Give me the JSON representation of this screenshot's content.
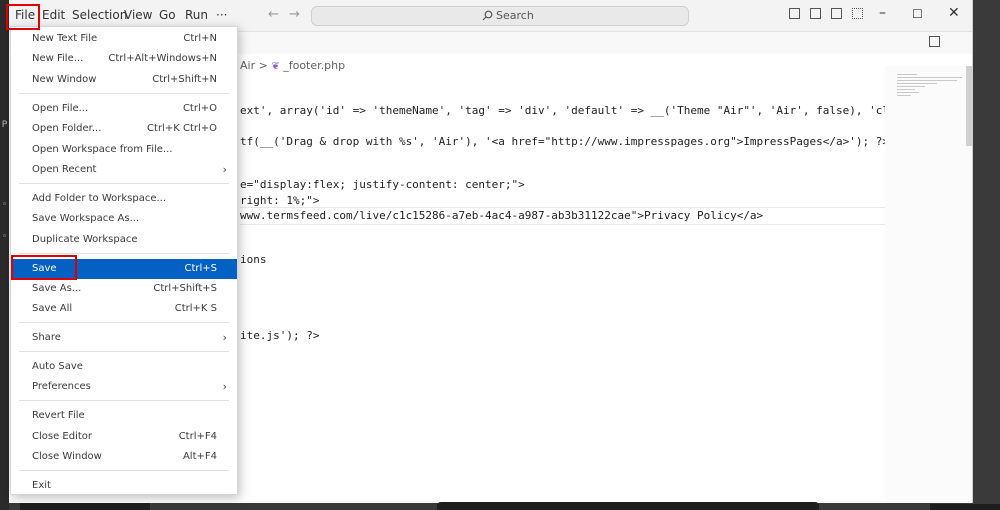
{
  "menubar": {
    "items": [
      "File",
      "Edit",
      "Selection",
      "View",
      "Go",
      "Run",
      "···"
    ]
  },
  "search": {
    "label": "Search"
  },
  "breadcrumb": {
    "folder": "Air",
    "separator": ">",
    "file": "_footer.php"
  },
  "code": {
    "lines": [
      "ext', array('id' => 'themeName', 'tag' => 'div', 'default' => __('Theme \"Air\"', 'Air', false), 'class' => '",
      "tf(__('Drag & drop with %s', 'Air'), '<a href=\"http://www.impresspages.org\">ImpressPages</a>'); ?>",
      "e=\"display:flex; justify-content: center;\">",
      "right: 1%;\">",
      "www.termsfeed.com/live/c1c15286-a7eb-4ac4-a987-ab3b31122cae\">Privacy Policy</a>",
      "ions",
      "ite.js'); ?>"
    ]
  },
  "file_menu": {
    "items": [
      {
        "label": "New Text File",
        "shortcut": "Ctrl+N"
      },
      {
        "label": "New File...",
        "shortcut": "Ctrl+Alt+Windows+N"
      },
      {
        "label": "New Window",
        "shortcut": "Ctrl+Shift+N"
      },
      {
        "label": "Open File...",
        "shortcut": "Ctrl+O"
      },
      {
        "label": "Open Folder...",
        "shortcut": "Ctrl+K Ctrl+O"
      },
      {
        "label": "Open Workspace from File...",
        "shortcut": ""
      },
      {
        "label": "Open Recent",
        "shortcut": ""
      },
      {
        "label": "Add Folder to Workspace...",
        "shortcut": ""
      },
      {
        "label": "Save Workspace As...",
        "shortcut": ""
      },
      {
        "label": "Duplicate Workspace",
        "shortcut": ""
      },
      {
        "label": "Save",
        "shortcut": "Ctrl+S"
      },
      {
        "label": "Save As...",
        "shortcut": "Ctrl+Shift+S"
      },
      {
        "label": "Save All",
        "shortcut": "Ctrl+K S"
      },
      {
        "label": "Share",
        "shortcut": ""
      },
      {
        "label": "Auto Save",
        "shortcut": ""
      },
      {
        "label": "Preferences",
        "shortcut": ""
      },
      {
        "label": "Revert File",
        "shortcut": ""
      },
      {
        "label": "Close Editor",
        "shortcut": "Ctrl+F4"
      },
      {
        "label": "Close Window",
        "shortcut": "Alt+F4"
      },
      {
        "label": "Exit",
        "shortcut": ""
      }
    ],
    "submenu_indicator": "›"
  },
  "colors": {
    "selection": "#0560c4",
    "highlight_box": "#e00000",
    "string": "#a31515",
    "link": "#0000ff"
  }
}
